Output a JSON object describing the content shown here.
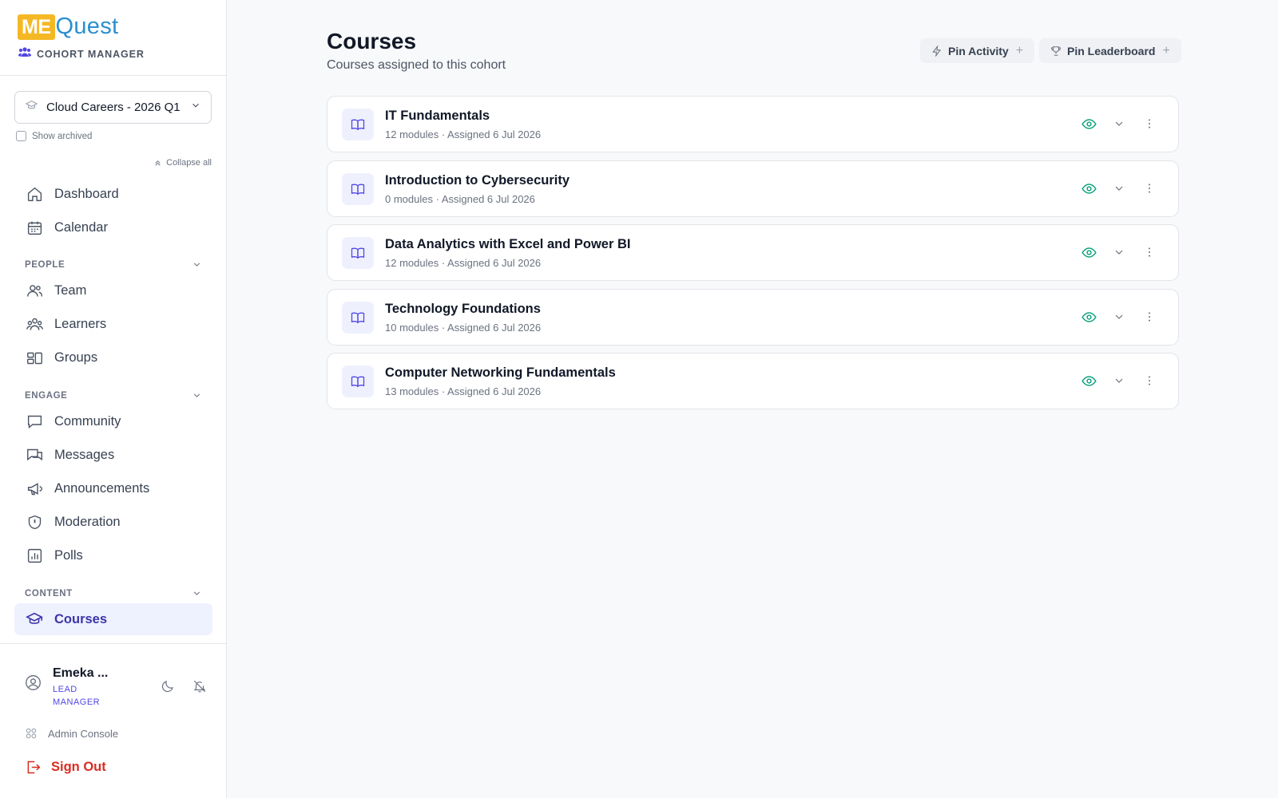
{
  "brand": {
    "logo_me": "ME",
    "logo_quest": "Quest",
    "subtitle": "COHORT MANAGER"
  },
  "cohort": {
    "selected": "Cloud Careers - 2026 Q1",
    "show_archived_label": "Show archived"
  },
  "collapse_all_label": "Collapse all",
  "nav": {
    "dashboard": "Dashboard",
    "calendar": "Calendar",
    "people_section": "PEOPLE",
    "team": "Team",
    "learners": "Learners",
    "groups": "Groups",
    "engage_section": "ENGAGE",
    "community": "Community",
    "messages": "Messages",
    "announcements": "Announcements",
    "moderation": "Moderation",
    "polls": "Polls",
    "content_section": "CONTENT",
    "courses": "Courses"
  },
  "user": {
    "name": "Emeka ...",
    "role": "LEAD MANAGER"
  },
  "footer": {
    "admin_console": "Admin Console",
    "sign_out": "Sign Out"
  },
  "page": {
    "title": "Courses",
    "subtitle": "Courses assigned to this cohort",
    "pin_activity": "Pin Activity",
    "pin_leaderboard": "Pin Leaderboard"
  },
  "courses": [
    {
      "name": "IT Fundamentals",
      "meta": "12 modules · Assigned 6 Jul 2026"
    },
    {
      "name": "Introduction to Cybersecurity",
      "meta": "0 modules · Assigned 6 Jul 2026"
    },
    {
      "name": "Data Analytics with Excel and Power BI",
      "meta": "12 modules · Assigned 6 Jul 2026"
    },
    {
      "name": "Technology Foundations",
      "meta": "10 modules · Assigned 6 Jul 2026"
    },
    {
      "name": "Computer Networking Fundamentals",
      "meta": "13 modules · Assigned 6 Jul 2026"
    }
  ],
  "colors": {
    "accent": "#4f46e5",
    "active_bg": "#eef1fe",
    "logo_yellow": "#f5b824",
    "logo_blue": "#2a8fcf",
    "visible_green": "#10a37f",
    "danger": "#d92d20"
  },
  "icons": {
    "dashboard": "home-icon",
    "calendar": "calendar-icon",
    "team": "users-icon",
    "learners": "learners-icon",
    "groups": "groups-icon",
    "community": "chat-icon",
    "messages": "messages-icon",
    "announcements": "megaphone-icon",
    "moderation": "shield-icon",
    "polls": "poll-icon",
    "courses": "graduation-cap-icon",
    "course_row": "book-open-icon",
    "visibility": "eye-icon",
    "expand": "chevron-down-icon",
    "more": "more-vertical-icon"
  }
}
